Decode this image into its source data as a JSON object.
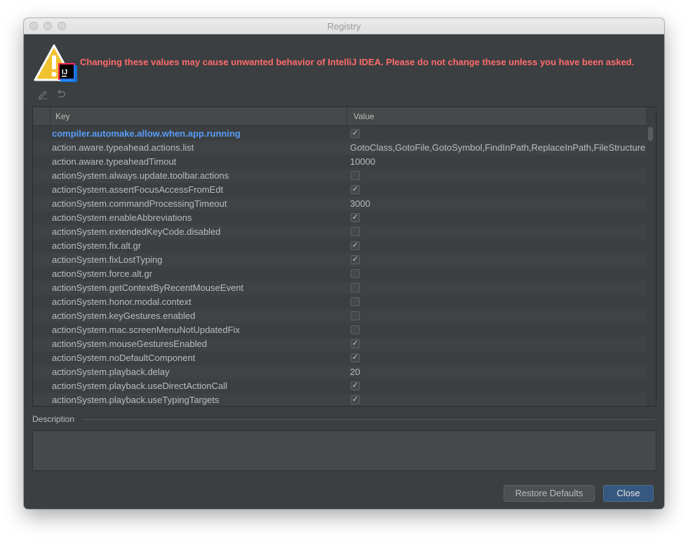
{
  "window": {
    "title": "Registry"
  },
  "warning": {
    "text": "Changing these values may cause unwanted behavior of IntelliJ IDEA. Please do not change these unless you have been asked."
  },
  "toolbar": {
    "edit_icon": "pencil-icon",
    "revert_icon": "undo-icon"
  },
  "table": {
    "columns": [
      "Key",
      "Value"
    ],
    "rows": [
      {
        "key": "compiler.automake.allow.when.app.running",
        "type": "checkbox",
        "checked": true,
        "modified": true
      },
      {
        "key": "action.aware.typeahead.actions.list",
        "type": "text",
        "value": "GotoClass,GotoFile,GotoSymbol,FindInPath,ReplaceInPath,FileStructure"
      },
      {
        "key": "action.aware.typeaheadTimout",
        "type": "text",
        "value": "10000"
      },
      {
        "key": "actionSystem.always.update.toolbar.actions",
        "type": "checkbox",
        "checked": false
      },
      {
        "key": "actionSystem.assertFocusAccessFromEdt",
        "type": "checkbox",
        "checked": true
      },
      {
        "key": "actionSystem.commandProcessingTimeout",
        "type": "text",
        "value": "3000"
      },
      {
        "key": "actionSystem.enableAbbreviations",
        "type": "checkbox",
        "checked": true
      },
      {
        "key": "actionSystem.extendedKeyCode.disabled",
        "type": "checkbox",
        "checked": false
      },
      {
        "key": "actionSystem.fix.alt.gr",
        "type": "checkbox",
        "checked": true
      },
      {
        "key": "actionSystem.fixLostTyping",
        "type": "checkbox",
        "checked": true
      },
      {
        "key": "actionSystem.force.alt.gr",
        "type": "checkbox",
        "checked": false
      },
      {
        "key": "actionSystem.getContextByRecentMouseEvent",
        "type": "checkbox",
        "checked": false
      },
      {
        "key": "actionSystem.honor.modal.context",
        "type": "checkbox",
        "checked": false
      },
      {
        "key": "actionSystem.keyGestures.enabled",
        "type": "checkbox",
        "checked": false
      },
      {
        "key": "actionSystem.mac.screenMenuNotUpdatedFix",
        "type": "checkbox",
        "checked": false
      },
      {
        "key": "actionSystem.mouseGesturesEnabled",
        "type": "checkbox",
        "checked": true
      },
      {
        "key": "actionSystem.noDefaultComponent",
        "type": "checkbox",
        "checked": true
      },
      {
        "key": "actionSystem.playback.delay",
        "type": "text",
        "value": "20"
      },
      {
        "key": "actionSystem.playback.useDirectActionCall",
        "type": "checkbox",
        "checked": true
      },
      {
        "key": "actionSystem.playback.useTypingTargets",
        "type": "checkbox",
        "checked": true
      }
    ]
  },
  "description": {
    "label": "Description"
  },
  "buttons": {
    "restore": "Restore Defaults",
    "close": "Close"
  },
  "colors": {
    "background": "#3c3f41",
    "warning": "#ff6b6b",
    "modified_key": "#589df6",
    "primary_button": "#365880"
  }
}
